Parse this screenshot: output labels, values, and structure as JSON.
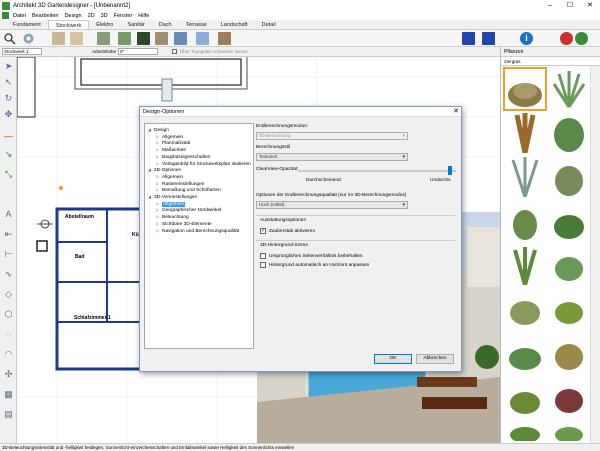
{
  "window": {
    "title": "Architekt 3D Gartendesigner - [Unbenannt2]"
  },
  "menu": [
    "Datei",
    "Bearbeiten",
    "Design",
    "2D",
    "3D",
    "Fenster",
    "Hilfe"
  ],
  "tabs": [
    "Fundament",
    "Stockwerk",
    "Elektro",
    "Sanitär",
    "Dach",
    "Terrasse",
    "Landschaft",
    "Detail"
  ],
  "propbar": {
    "floor_label": "Stockwerk 1",
    "height_label": "Arbeitshöhe",
    "height_value": "0\"",
    "topo_label": "Über Topografie schweben lassen"
  },
  "rightpanel": {
    "title": "Pflanzen",
    "category": "Ziergras"
  },
  "canvas": {
    "room1": "Abstellraum",
    "room2": "Kü",
    "room3": "Bad",
    "room4": "Schlafzimmer 1"
  },
  "dialog": {
    "title": "Design-Optionen",
    "tree": [
      {
        "label": "Design",
        "level": 0
      },
      {
        "label": "Allgemein",
        "level": 1
      },
      {
        "label": "Planmaßstab",
        "level": 1
      },
      {
        "label": "Maßeinheit",
        "level": 1
      },
      {
        "label": "Bauplatzeigenschaften",
        "level": 1
      },
      {
        "label": "Vorlagenbild für Stockwerksplan skalieren",
        "level": 1
      },
      {
        "label": "2D-Optionen",
        "level": 0
      },
      {
        "label": "Allgemein",
        "level": 1
      },
      {
        "label": "Rastereinstellungen",
        "level": 1
      },
      {
        "label": "Bemaßung und Schriftarten",
        "level": 1
      },
      {
        "label": "3D-Voreinstellungen",
        "level": 0
      },
      {
        "label": "Allgemein",
        "level": 1,
        "selected": true
      },
      {
        "label": "Geographischer Nordwinkel",
        "level": 1
      },
      {
        "label": "Beleuchtung",
        "level": 1
      },
      {
        "label": "Sichtbare 3D-Elemente",
        "level": 1
      },
      {
        "label": "Navigation und Berechnungsqualität",
        "level": 1
      }
    ],
    "endberechnung_label": "Endberechnungsmodus:",
    "endberechnung_value": "3D-Berechnung",
    "berechnungsstil_label": "Berechnungsstil",
    "berechnungsstil_value": "Texturiert",
    "clearview_label": "ClearView-Opazität:",
    "slider_left": "Durchscheinend",
    "slider_right": "Undurchs",
    "clearview_level": 0.96,
    "quality_label": "Optionen der Endberechnungsqualität (nur im 3D-Berechnungsmodus)",
    "quality_value": "Hoch (mittel)",
    "ausstattung_label": "Ausstattungsoptionen",
    "zauberstab_label": "Zauberstab aktivieren",
    "zauberstab_checked": true,
    "hintergrund_label": "3D-Hintergrund-Szene",
    "seitenverh_label": "Ursprüngliches Seitenverhältnis beibehalten",
    "horizont_label": "Hintergrund automatisch an Horizont anpassen",
    "ok": "OK",
    "cancel": "Abbrechen"
  },
  "status": "3D-Beleuchtungsintensität und -helligkeit festlegen, Sonnenlicht-einzeichenschaften und Einfallswinkel sowie Helligkeit des Sonnenlichts einstellen",
  "colors": {
    "accent": "#3399ff",
    "wall": "#1e3a8a",
    "plant_sel": "#f0a020"
  }
}
